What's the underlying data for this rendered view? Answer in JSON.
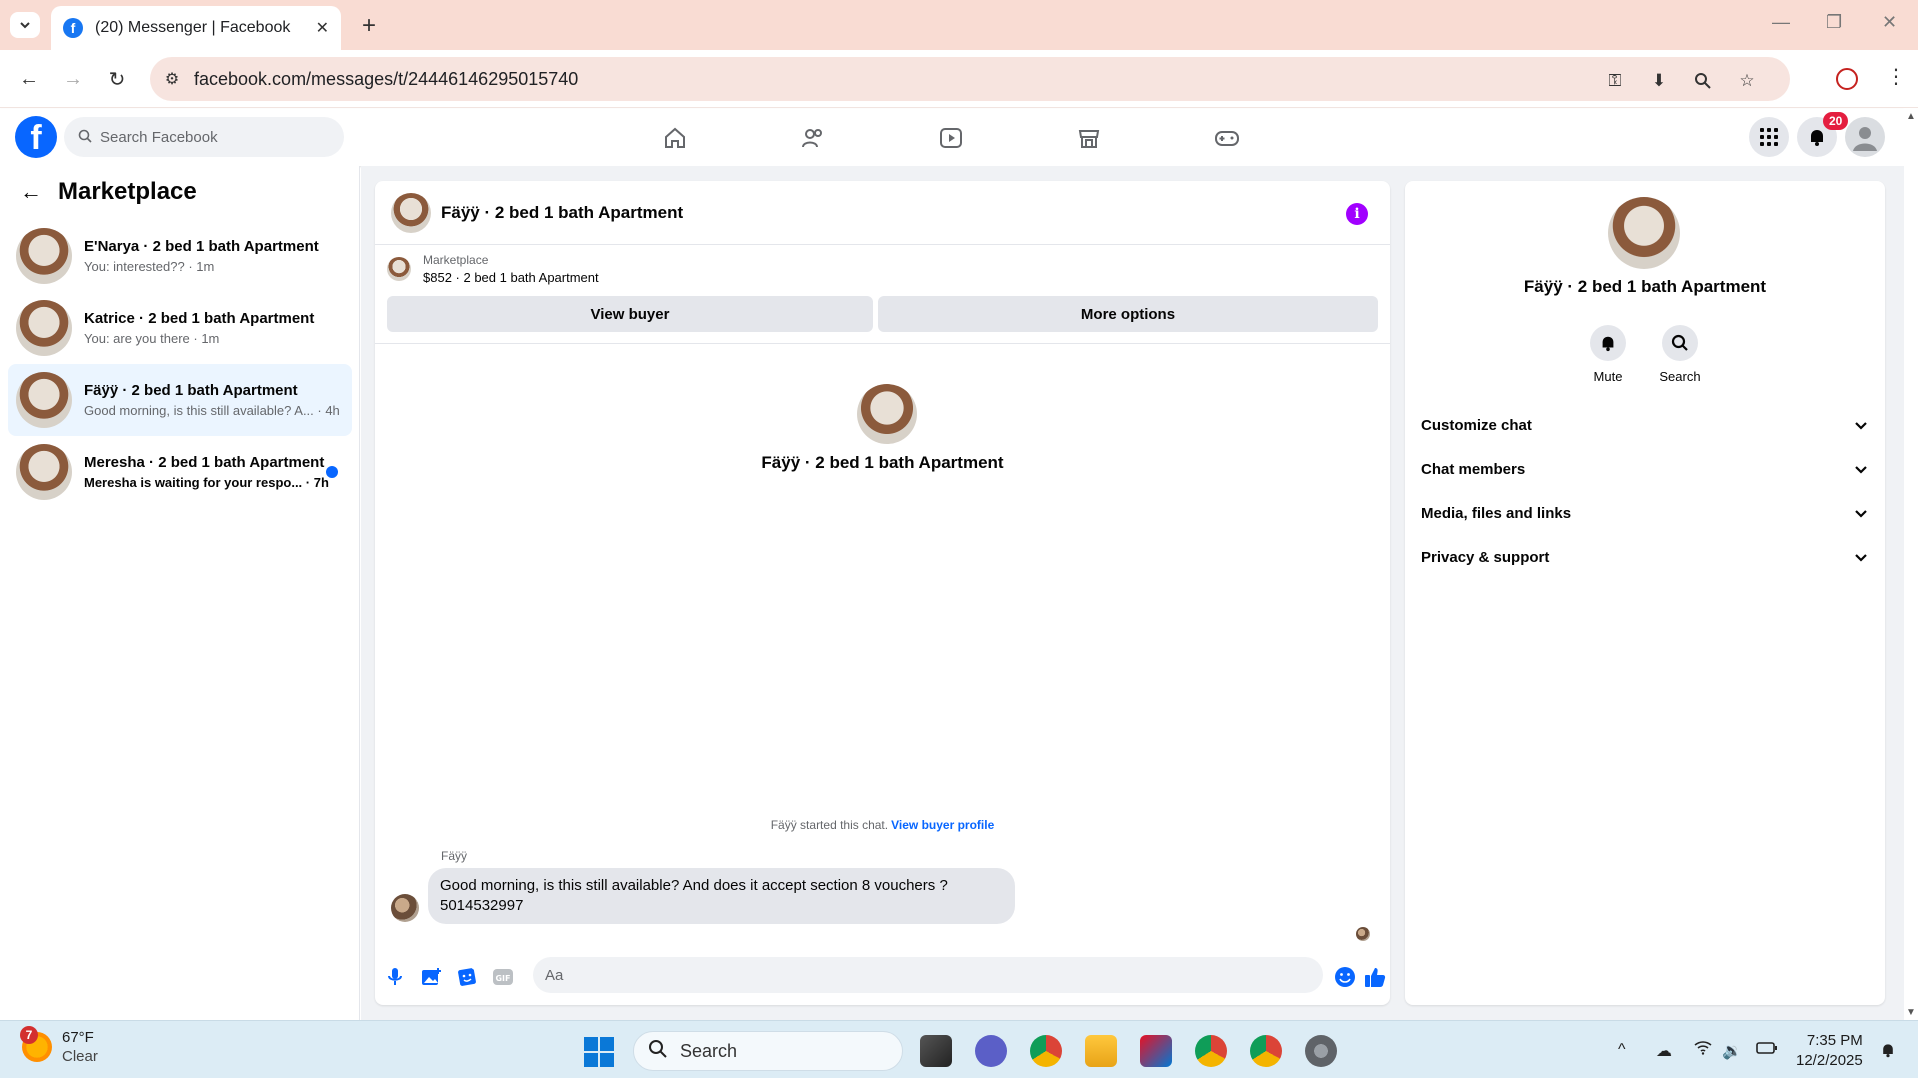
{
  "browser": {
    "tab_title": "(20) Messenger | Facebook",
    "url": "facebook.com/messages/t/24446146295015740"
  },
  "fb": {
    "search_placeholder": "Search Facebook",
    "notification_count": "20"
  },
  "sidebar": {
    "title": "Marketplace",
    "conversations": [
      {
        "name": "E'Narya · 2 bed 1 bath Apartment",
        "preview": "You: interested?? · 1m",
        "active": false,
        "unread": false
      },
      {
        "name": "Katrice · 2 bed 1 bath Apartment",
        "preview": "You: are you there · 1m",
        "active": false,
        "unread": false
      },
      {
        "name": "Fäÿÿ · 2 bed 1 bath Apartment",
        "preview": "Good morning, is this still available? A... · 4h",
        "active": true,
        "unread": false
      },
      {
        "name": "Meresha · 2 bed 1 bath Apartment",
        "preview": "Meresha is waiting for your respo... · 7h",
        "active": false,
        "unread": true
      }
    ]
  },
  "chat": {
    "header_name": "Fäÿÿ · 2 bed 1 bath Apartment",
    "marketplace_label": "Marketplace",
    "listing": "$852 · 2 bed 1 bath Apartment",
    "view_buyer_label": "View buyer",
    "more_options_label": "More options",
    "center_name": "Fäÿÿ · 2 bed 1 bath Apartment",
    "started_text": "Fäÿÿ started this chat.",
    "view_buyer_profile_label": "View buyer profile",
    "sender": "Fäÿÿ",
    "message_line1": "Good morning, is this still available? And does it accept section 8 vouchers ?",
    "message_line2": "5014532997",
    "composer_placeholder": "Aa"
  },
  "panel": {
    "name": "Fäÿÿ · 2 bed 1 bath Apartment",
    "mute_label": "Mute",
    "search_label": "Search",
    "sections": [
      "Customize chat",
      "Chat members",
      "Media, files and links",
      "Privacy & support"
    ]
  },
  "taskbar": {
    "weather_badge": "7",
    "temp": "67°F",
    "condition": "Clear",
    "search_label": "Search",
    "time": "7:35 PM",
    "date": "12/2/2025"
  },
  "colors": {
    "fb_blue": "#0866ff",
    "active_conv_bg": "#ebf5ff",
    "info_purple": "#a100ff",
    "tab_strip": "#f9dcd3"
  }
}
